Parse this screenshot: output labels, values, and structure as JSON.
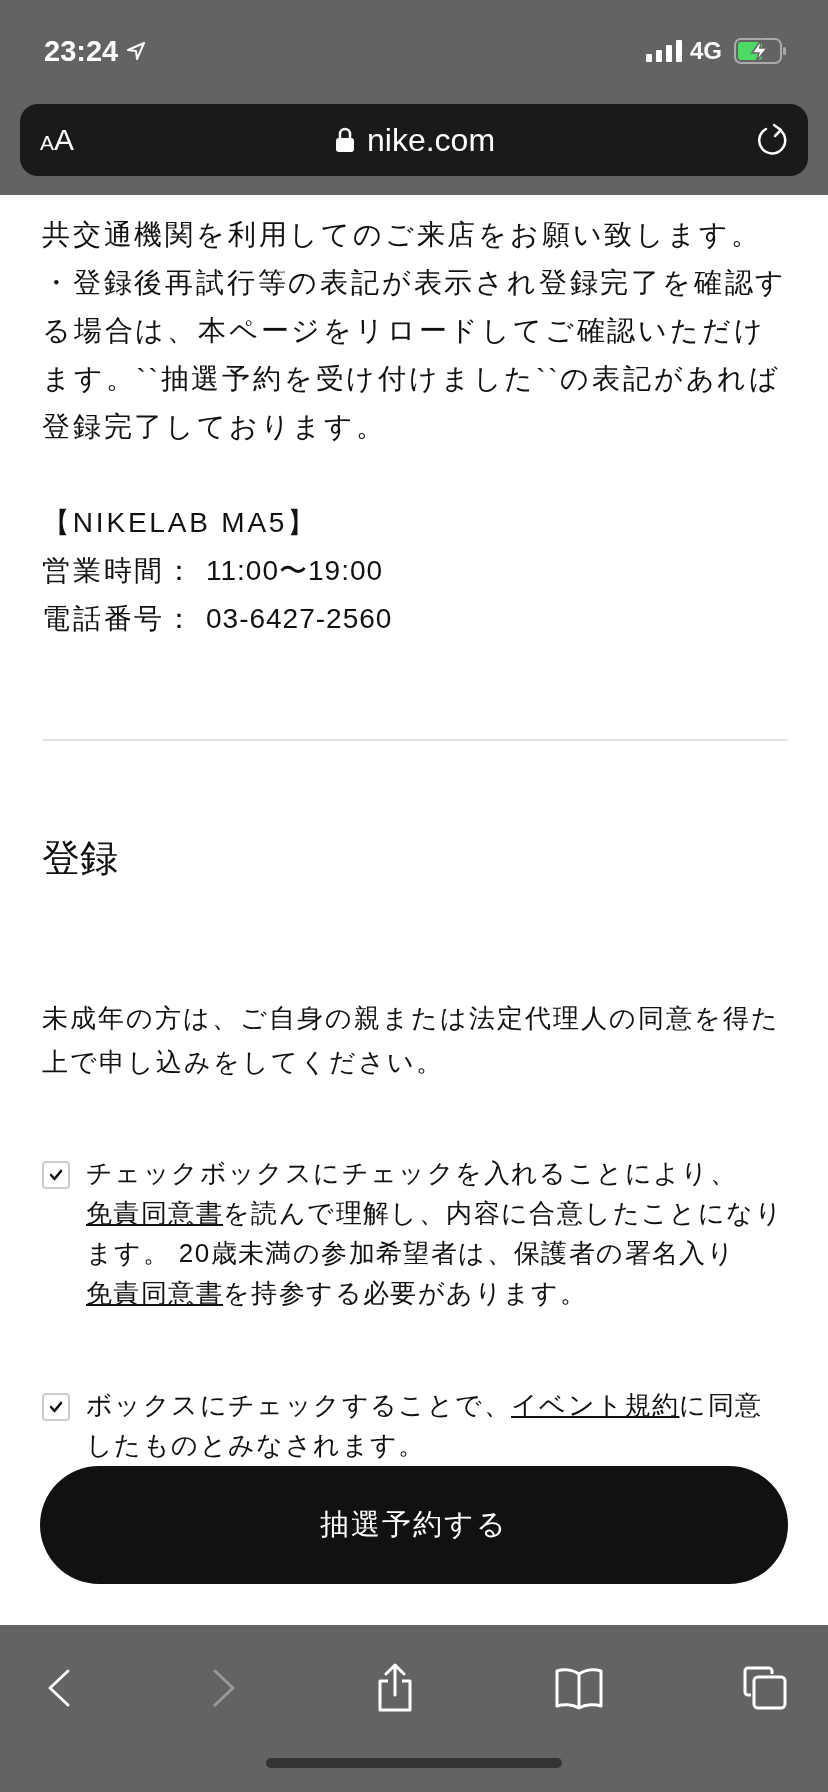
{
  "status_bar": {
    "time": "23:24",
    "network": "4G"
  },
  "address_bar": {
    "text_size_button": "AA",
    "url": "nike.com"
  },
  "notes": [
    "共交通機関を利用してのご来店をお願い致します。",
    "・登録後再試行等の表記が表示され登録完了を確認する場合は、本ページをリロードしてご確認いただけます。``抽選予約を受け付けました``の表記があれば登録完了しております。"
  ],
  "store": {
    "name": "【NIKELAB MA5】",
    "rows": [
      {
        "label": "営業時間：",
        "value": "11:00〜19:00"
      },
      {
        "label": "電話番号：",
        "value": "03-6427-2560"
      }
    ]
  },
  "section_title": "登録",
  "minor_note": "未成年の方は、ご自身の親または法定代理人の同意を得た上で申し込みをしてください。",
  "consents": [
    {
      "checked": true,
      "parts": [
        {
          "text": "チェックボックスにチェックを入れることにより、",
          "link": false
        },
        {
          "text": "免責同意書",
          "link": true
        },
        {
          "text": "を読んで理解し、内容に合意したことになります。 20歳未満の参加希望者は、保護者の署名入り",
          "link": false
        },
        {
          "text": "免責同意書",
          "link": true
        },
        {
          "text": "を持参する必要があります。",
          "link": false
        }
      ]
    },
    {
      "checked": true,
      "parts": [
        {
          "text": "ボックスにチェックすることで、",
          "link": false
        },
        {
          "text": "イベント規約",
          "link": true
        },
        {
          "text": "に同意したものとみなされます。",
          "link": false
        }
      ]
    }
  ],
  "submit_button": "抽選予約する",
  "toolbar": [
    {
      "kind": "back",
      "disabled": false
    },
    {
      "kind": "forward",
      "disabled": true
    },
    {
      "kind": "share",
      "disabled": false
    },
    {
      "kind": "bookmarks",
      "disabled": false
    },
    {
      "kind": "tabs",
      "disabled": false
    }
  ]
}
